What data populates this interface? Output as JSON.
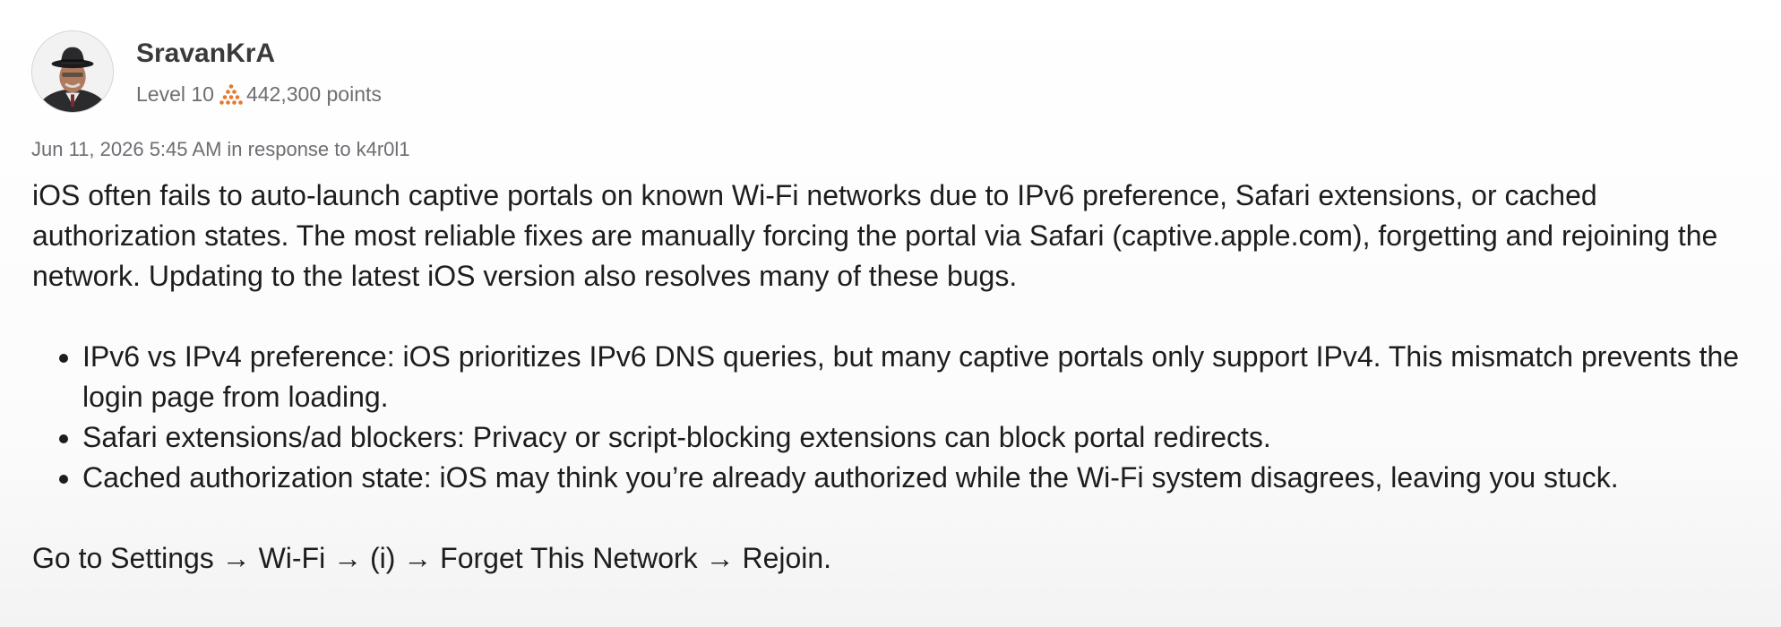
{
  "author": {
    "name": "SravanKrA",
    "level": "Level 10",
    "points": "442,300 points",
    "level_icon": "pyramid-icon",
    "accent_color": "#e8772e"
  },
  "meta": {
    "date": "Jun 11, 2026 5:45 AM",
    "response_text": "in response to",
    "response_to": "k4r0l1"
  },
  "post": {
    "intro": "iOS often fails to auto-launch captive portals on known Wi-Fi networks due to IPv6 preference, Safari extensions, or cached authorization states. The most reliable fixes are manually forcing the portal via Safari (captive.apple.com), forgetting and rejoining the network. Updating to the latest iOS version also resolves many of these bugs.",
    "bullets": [
      "IPv6 vs IPv4 preference: iOS prioritizes IPv6 DNS queries, but many captive portals only support IPv4. This mismatch prevents the login page from loading.",
      "Safari extensions/ad blockers: Privacy or script-blocking extensions can block portal redirects.",
      "Cached authorization state: iOS may think you’re already authorized while the Wi-Fi system disagrees, leaving you stuck."
    ],
    "closing": "Go to Settings → Wi-Fi → (i) → Forget This Network → Rejoin."
  }
}
